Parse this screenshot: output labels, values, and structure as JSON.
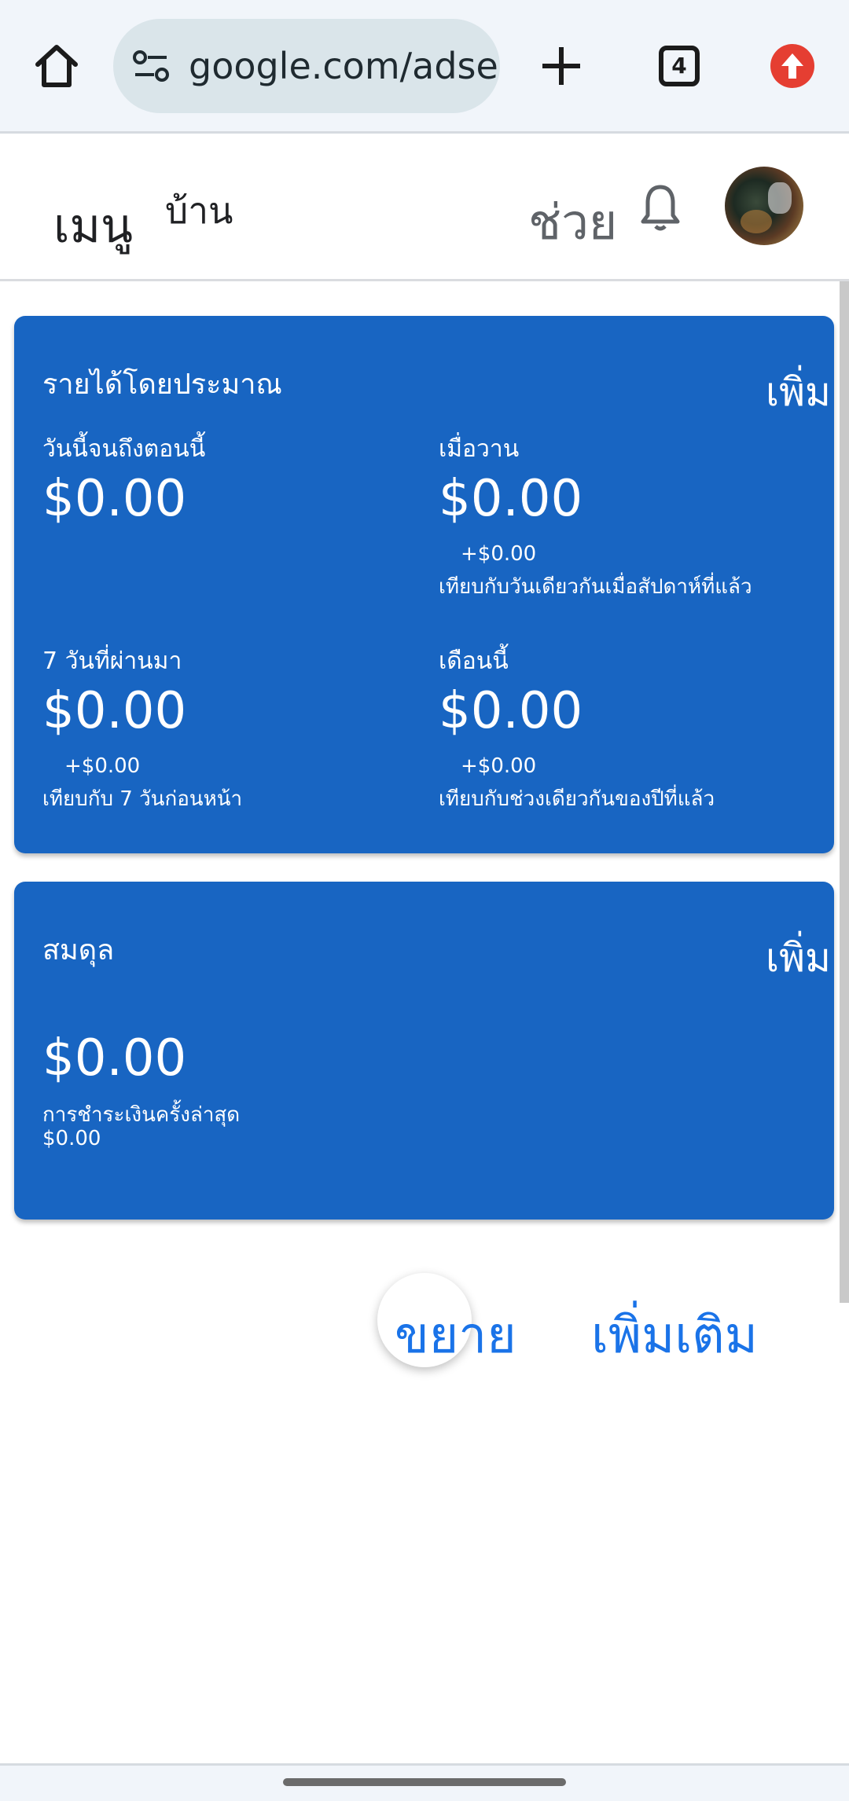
{
  "browser": {
    "url": "google.com/adse",
    "tab_count": "4",
    "icons": [
      "home-icon",
      "tune-icon",
      "plus-icon",
      "tabs-icon",
      "update-arrow-icon"
    ],
    "update_color": "#e53e32"
  },
  "header": {
    "menu_label": "เมนู",
    "home_label": "บ้าน",
    "help_label": "ช่วย",
    "icons": [
      "bell-icon",
      "avatar"
    ]
  },
  "earnings_card": {
    "title": "รายได้โดยประมาณ",
    "more_label": "เพิ่ม",
    "today": {
      "label": "วันนี้จนถึงตอนนี้",
      "value": "$0.00"
    },
    "yesterday": {
      "label": "เมื่อวาน",
      "value": "$0.00",
      "delta": "+$0.00",
      "compare": "เทียบกับวันเดียวกันเมื่อสัปดาห์ที่แล้ว"
    },
    "last7": {
      "label": "7 วันที่ผ่านมา",
      "value": "$0.00",
      "delta": "+$0.00",
      "compare": "เทียบกับ 7 วันก่อนหน้า"
    },
    "month": {
      "label": "เดือนนี้",
      "value": "$0.00",
      "delta": "+$0.00",
      "compare": "เทียบกับช่วงเดียวกันของปีที่แล้ว"
    },
    "color": "#1865c2"
  },
  "balance_card": {
    "title": "สมดุล",
    "more_label": "เพิ่ม",
    "value": "$0.00",
    "last_payment_label": "การชำระเงินครั้งล่าสุด",
    "last_payment_value": "$0.00"
  },
  "actions": {
    "expand_label": "ขยาย",
    "more_label": "เพิ่มเติม",
    "link_color": "#1a73e8"
  }
}
